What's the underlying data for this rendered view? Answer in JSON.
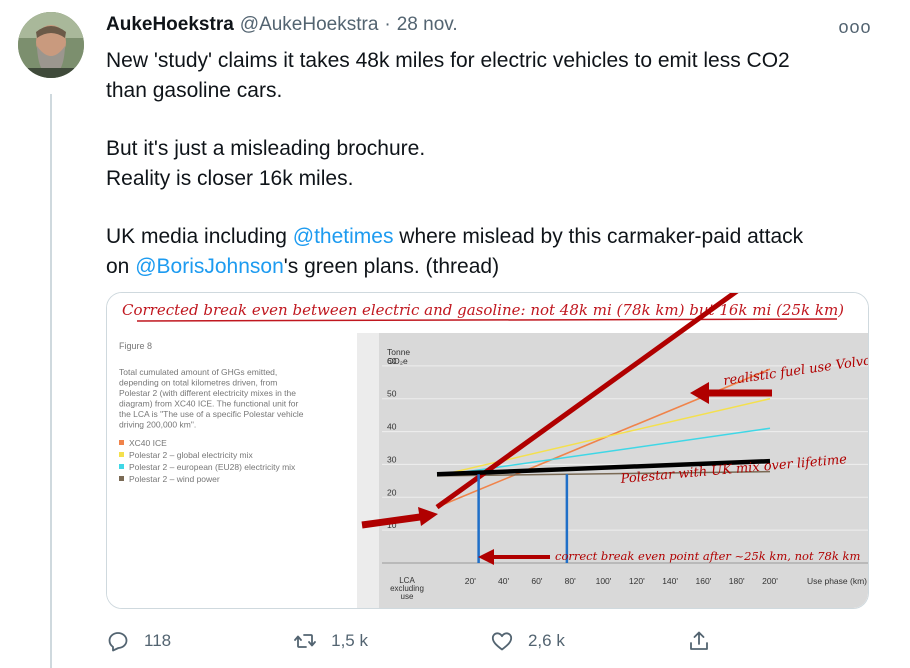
{
  "tweet": {
    "display_name": "AukeHoekstra",
    "handle": "@AukeHoekstra",
    "separator": "·",
    "date": "28 nov.",
    "more_label": "ooo",
    "text": {
      "line1": "New 'study' claims it takes 48k miles for electric vehicles to emit less CO2",
      "line2": "than gasoline cars.",
      "line3": "But it's just a misleading brochure.",
      "line4": "Reality is closer 16k miles.",
      "line5_pre": "UK media including ",
      "mention1": "@thetimes",
      "line5_post": " where mislead by this carmaker-paid attack",
      "line6_pre": "on ",
      "mention2": "@BorisJohnson",
      "line6_post": "'s green plans. (thread)"
    },
    "actions": {
      "reply_count": "118",
      "retweet_count": "1,5 k",
      "like_count": "2,6 k"
    },
    "icons": [
      "reply-icon",
      "retweet-icon",
      "like-icon",
      "share-icon",
      "more-icon"
    ]
  },
  "media": {
    "annotation_title": "Corrected break even between electric and gasoline: not 48k mi (78k km) but 16k mi (25k km)",
    "figure_label": "Figure 8",
    "figure_caption": [
      "Total cumulated amount of GHGs emitted,",
      "depending on total kilometres driven, from",
      "Polestar 2 (with different electricity mixes in the",
      "diagram) from XC40 ICE. The functional unit for",
      "the LCA is \"The use of a specific Polestar vehicle",
      "driving 200,000 km\"."
    ],
    "legend": [
      {
        "label": "XC40 ICE",
        "color": "#f0834a"
      },
      {
        "label": "Polestar 2 – global electricity mix",
        "color": "#f4e04d"
      },
      {
        "label": "Polestar 2 – european (EU28) electricity mix",
        "color": "#3fd7e6"
      },
      {
        "label": "Polestar 2 – wind power",
        "color": "#7a6a55"
      }
    ],
    "note_volvo": "realistic fuel use Volvo",
    "note_polestar": "Polestar with UK mix over lifetime",
    "note_breakeven": "correct break even point after ~25k km, not 78k km",
    "chart_data": {
      "type": "line",
      "ylabel_line1": "Tonne",
      "ylabel_line2": "CO₂e",
      "xlabel": "Use phase (km)",
      "x_first_label": [
        "LCA",
        "excluding",
        "use"
      ],
      "y_ticks": [
        "10",
        "20",
        "30",
        "40",
        "50",
        "60"
      ],
      "x_ticks": [
        "20'",
        "40'",
        "60'",
        "80'",
        "100'",
        "120'",
        "140'",
        "160'",
        "180'",
        "200'"
      ],
      "ylim": [
        0,
        70
      ],
      "xlim": [
        0,
        200
      ],
      "series": [
        {
          "name": "XC40 ICE",
          "color": "#f0834a",
          "x": [
            0,
            200
          ],
          "y": [
            17,
            59
          ]
        },
        {
          "name": "Polestar 2 – global electricity mix",
          "color": "#f4e04d",
          "x": [
            0,
            200
          ],
          "y": [
            26.5,
            50
          ]
        },
        {
          "name": "Polestar 2 – european (EU28) electricity mix",
          "color": "#3fd7e6",
          "x": [
            0,
            200
          ],
          "y": [
            26.5,
            41
          ]
        },
        {
          "name": "Polestar 2 – wind power",
          "color": "#7a6a55",
          "x": [
            0,
            200
          ],
          "y": [
            26.5,
            27.8
          ]
        },
        {
          "name": "realistic fuel use Volvo",
          "color": "#b00000",
          "x": [
            0,
            200
          ],
          "y": [
            17,
            90
          ]
        },
        {
          "name": "Polestar with UK mix over lifetime",
          "color": "#000000",
          "x": [
            0,
            200
          ],
          "y": [
            27,
            31
          ]
        }
      ],
      "vlines_x": [
        25,
        78
      ]
    }
  }
}
